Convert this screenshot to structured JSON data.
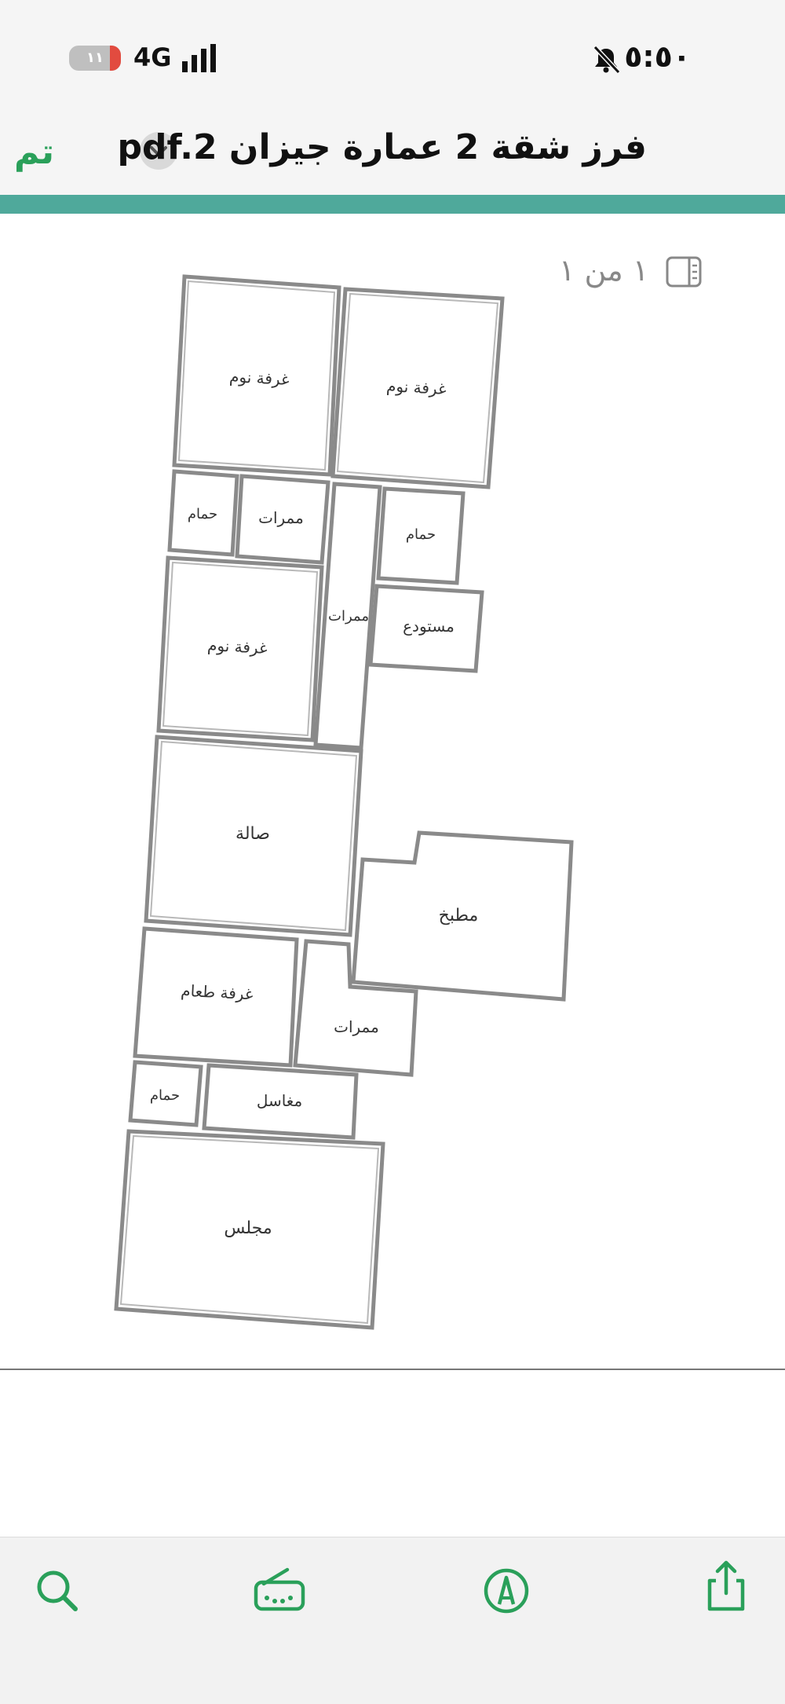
{
  "status_bar": {
    "time": "٥:٥٠",
    "network": "4G",
    "battery_level": "١١"
  },
  "header": {
    "done_label": "تم",
    "document_title": "فرز شقة 2 عمارة جيزان pdf.2"
  },
  "viewer": {
    "page_indicator": "١ من ١"
  },
  "floor_plan": {
    "rooms": {
      "bedroom_top_left": "غرفة نوم",
      "bedroom_top_right": "غرفة نوم",
      "bathroom_1": "حمام",
      "corridor_1": "ممرات",
      "corridor_vertical": "ممرات",
      "bathroom_2": "حمام",
      "storage": "مستودع",
      "bedroom_middle": "غرفة نوم",
      "hall": "صالة",
      "kitchen": "مطبخ",
      "dining_room": "غرفة طعام",
      "corridor_2": "ممرات",
      "bathroom_3": "حمام",
      "washbasins": "مغاسل",
      "majlis": "مجلس"
    }
  },
  "toolbar": {
    "icons": [
      "search-icon",
      "keyboard-markup-icon",
      "markup-pen-icon",
      "share-icon"
    ]
  },
  "colors": {
    "accent": "#4fa99b",
    "done_green": "#2aa05a"
  }
}
